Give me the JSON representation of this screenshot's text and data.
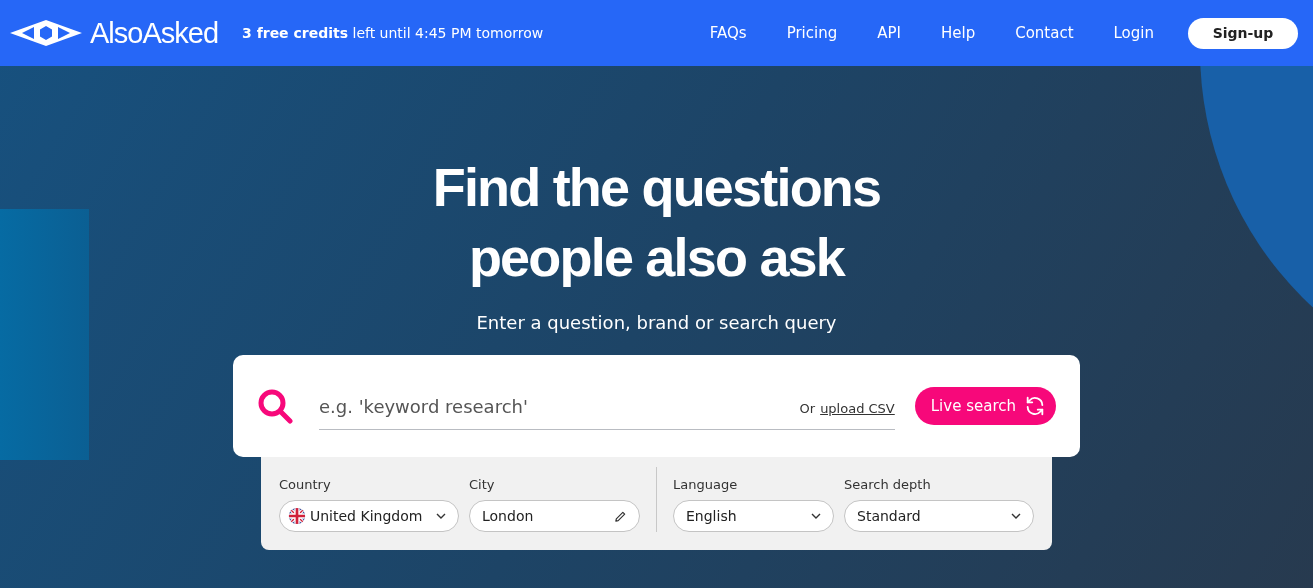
{
  "header": {
    "logo": "AlsoAsked",
    "credits": "**3 free credits** left until 4:45 PM tomorrow",
    "nav": [
      "FAQs",
      "Pricing",
      "API",
      "Help",
      "Contact",
      "Login"
    ],
    "signup": "Sign-up"
  },
  "hero": {
    "title_lines": [
      "Find the questions",
      "people also ask"
    ],
    "subtitle": "Enter a question, brand or search query"
  },
  "search": {
    "placeholder": "e.g. 'keyword research'",
    "upload_prefix": "Or",
    "upload_link": "upload CSV",
    "button": "Live search"
  },
  "option_groups": [
    [
      {
        "kind": "country",
        "label": "Country",
        "value": "United Kingdom"
      },
      {
        "kind": "text",
        "label": "City",
        "value": "London"
      }
    ],
    [
      {
        "kind": "select",
        "label": "Language",
        "value": "English"
      },
      {
        "kind": "select",
        "label": "Search depth",
        "value": "Standard"
      }
    ]
  ]
}
